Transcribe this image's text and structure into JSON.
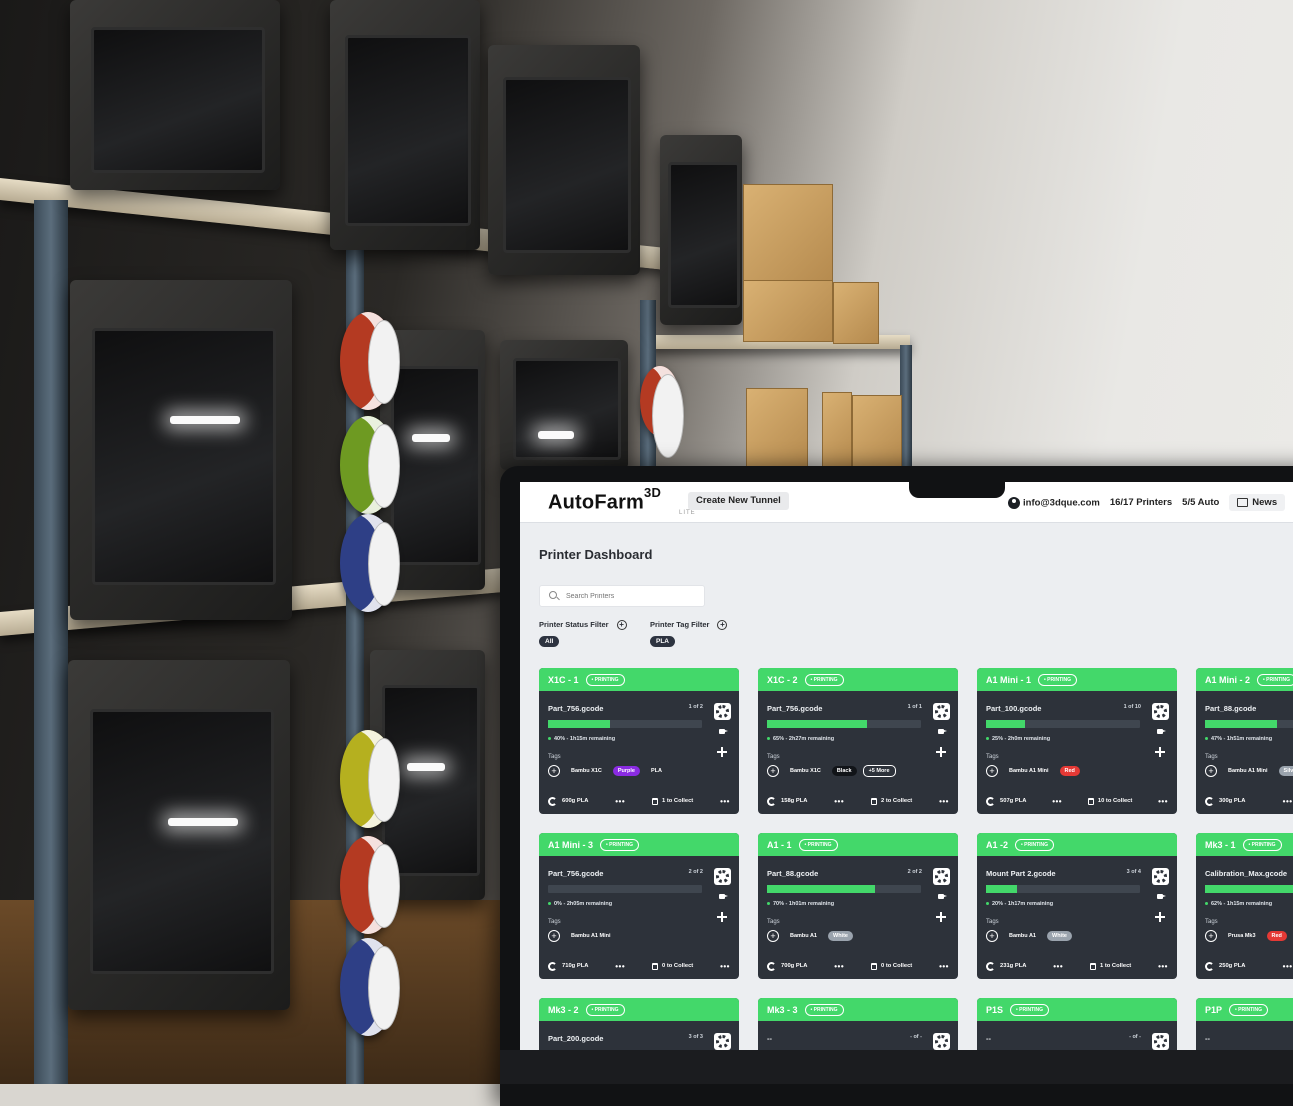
{
  "app": {
    "logo": "AutoFarm",
    "logo_sup": "3D",
    "logo_sub": "LITE",
    "create_tunnel": "Create New Tunnel",
    "email": "info@3dque.com",
    "printers_count": "16/17 Printers",
    "auto_count": "5/5 Auto",
    "news": "News"
  },
  "dashboard": {
    "title": "Printer Dashboard",
    "search_placeholder": "Search Printers",
    "status_filter_label": "Printer Status Filter",
    "status_filter_value": "All",
    "tag_filter_label": "Printer Tag Filter",
    "tag_filter_value": "PLA"
  },
  "colors": {
    "accent_green": "#43d86a",
    "card_bg": "#2d323a",
    "tag_purple": "#8a2be2",
    "tag_red": "#e53935",
    "tag_white": "#9aa3ad"
  },
  "cards": [
    {
      "name": "X1C - 1",
      "status": "• PRINTING",
      "file": "Part_756.gcode",
      "count": "1 of 2",
      "progress": 0.4,
      "remaining": "40% - 1h15m remaining",
      "tags_label": "Tags",
      "tags": [
        {
          "t": "Bambu X1C",
          "style": "plain"
        },
        {
          "t": "Purple",
          "style": "purple"
        },
        {
          "t": "PLA",
          "style": "plain"
        }
      ],
      "filament": "600g PLA",
      "collect": "1 to Collect"
    },
    {
      "name": "X1C - 2",
      "status": "• PRINTING",
      "file": "Part_756.gcode",
      "count": "1 of 1",
      "progress": 0.65,
      "remaining": "65% - 2h27m remaining",
      "tags_label": "Tags",
      "tags": [
        {
          "t": "Bambu X1C",
          "style": "plain"
        },
        {
          "t": "Black",
          "style": "black"
        },
        {
          "t": "+5 More",
          "style": "outline"
        }
      ],
      "filament": "158g PLA",
      "collect": "2 to Collect"
    },
    {
      "name": "A1 Mini  - 1",
      "status": "• PRINTING",
      "file": "Part_100.gcode",
      "count": "1 of 10",
      "progress": 0.25,
      "remaining": "25% - 2h0m remaining",
      "tags_label": "Tags",
      "tags": [
        {
          "t": "Bambu A1 Mini",
          "style": "plain"
        },
        {
          "t": "Red",
          "style": "red"
        }
      ],
      "filament": "507g PLA",
      "collect": "10 to Collect"
    },
    {
      "name": "A1 Mini - 2",
      "status": "• PRINTING",
      "file": "Part_88.gcode",
      "count": "",
      "progress": 0.47,
      "remaining": "47% - 1h51m remaining",
      "tags_label": "Tags",
      "tags": [
        {
          "t": "Bambu A1 Mini",
          "style": "plain"
        },
        {
          "t": "Silver",
          "style": "white"
        }
      ],
      "filament": "300g PLA",
      "collect": ""
    },
    {
      "name": "A1 Mini - 3",
      "status": "• PRINTING",
      "file": "Part_756.gcode",
      "count": "2 of 2",
      "progress": 0.0,
      "remaining": "0% - 2h05m remaining",
      "tags_label": "Tags",
      "tags": [
        {
          "t": "Bambu A1 Mini",
          "style": "plain"
        }
      ],
      "filament": "710g PLA",
      "collect": "0 to Collect"
    },
    {
      "name": "A1 - 1",
      "status": "• PRINTING",
      "file": "Part_88.gcode",
      "count": "2 of 2",
      "progress": 0.7,
      "remaining": "70% - 1h01m remaining",
      "tags_label": "Tags",
      "tags": [
        {
          "t": "Bambu A1",
          "style": "plain"
        },
        {
          "t": "White",
          "style": "white"
        }
      ],
      "filament": "700g PLA",
      "collect": "0 to Collect"
    },
    {
      "name": "A1 -2",
      "status": "• PRINTING",
      "file": "Mount Part 2.gcode",
      "count": "3 of 4",
      "progress": 0.2,
      "remaining": "20% - 1h17m remaining",
      "tags_label": "Tags",
      "tags": [
        {
          "t": "Bambu A1",
          "style": "plain"
        },
        {
          "t": "White",
          "style": "white"
        }
      ],
      "filament": "231g PLA",
      "collect": "1 to Collect"
    },
    {
      "name": "Mk3 - 1",
      "status": "• PRINTING",
      "file": "Calibration_Max.gcode",
      "count": "",
      "progress": 0.62,
      "remaining": "62% - 1h15m remaining",
      "tags_label": "Tags",
      "tags": [
        {
          "t": "Prusa Mk3",
          "style": "plain"
        },
        {
          "t": "Red",
          "style": "red"
        }
      ],
      "filament": "250g PLA",
      "collect": ""
    },
    {
      "name": "Mk3 - 2",
      "status": "• PRINTING",
      "file": "Part_200.gcode",
      "count": "3 of 3"
    },
    {
      "name": "Mk3 - 3",
      "status": "• PRINTING",
      "file": "--",
      "count": "- of -"
    },
    {
      "name": "P1S",
      "status": "• PRINTING",
      "file": "--",
      "count": "- of -"
    },
    {
      "name": "P1P",
      "status": "• PRINTING",
      "file": "--",
      "count": ""
    }
  ]
}
